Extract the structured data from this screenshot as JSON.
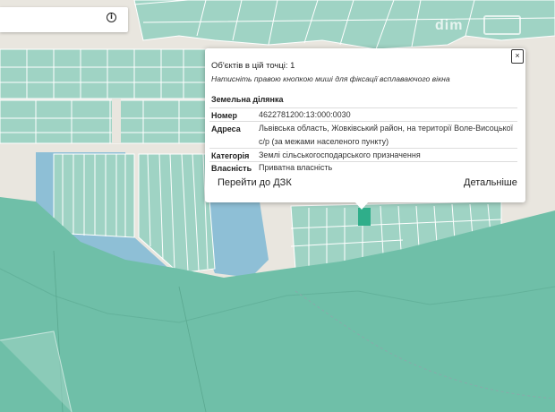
{
  "map": {
    "colors": {
      "background": "#e9e6df",
      "parcel_fill": "#9fd3c4",
      "parcel_stroke": "#ffffff",
      "water": "#8ebfd6",
      "forest": "#6fbfa8",
      "forest_dark": "#63b29b",
      "highlight": "#2fae8a",
      "road": "#f4f2ee"
    }
  },
  "toolbar": {
    "icon": "info-icon"
  },
  "watermark": {
    "text": "dim"
  },
  "popup": {
    "close_label": "×",
    "count_text": "Об'єктів в цій точці: 1",
    "hint_text": "Натисніть правою кнопкою миші для фіксації всплаваючого вікна",
    "section_title": "Земельна ділянка",
    "rows": [
      {
        "key": "Номер",
        "value": "4622781200:13:000:0030"
      },
      {
        "key": "Адреса",
        "value": "Львівська область, Жовківський район, на території Воле-Висоцької с/р (за межами населеного пункту)"
      },
      {
        "key": "Категорія",
        "value": "Землі сільськогосподарського призначення"
      },
      {
        "key": "Власність",
        "value": "Приватна власність"
      }
    ],
    "link_cadastre": "Перейти до ДЗК",
    "link_details": "Детальніше"
  }
}
